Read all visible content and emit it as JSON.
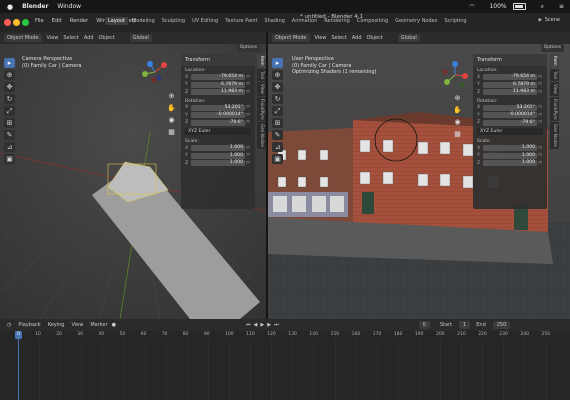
{
  "mac_menu": {
    "app": "Blender",
    "window": "Window",
    "battery": "100%"
  },
  "topbar": {
    "menus": [
      "File",
      "Edit",
      "Render",
      "Window",
      "Help"
    ],
    "tabs": [
      "Layout",
      "Modeling",
      "Sculpting",
      "UV Editing",
      "Texture Paint",
      "Shading",
      "Animation",
      "Rendering",
      "Compositing",
      "Geometry Nodes",
      "Scripting"
    ],
    "active_tab": "Layout",
    "title": "* untitled - Blender 4.1",
    "scene": "Scene"
  },
  "viewport_header": {
    "mode": "Object Mode",
    "menus": [
      "View",
      "Select",
      "Add",
      "Object"
    ],
    "orientation": "Global",
    "options": "Options"
  },
  "left_viewport": {
    "line1": "Camera Perspective",
    "line2": "(0) Family Car | Camera",
    "transform": {
      "title": "Transform",
      "location_label": "Location:",
      "location": [
        "-79.654 m",
        "6.7879 m",
        "11.983 m"
      ],
      "rotation_label": "Rotation:",
      "rotation": [
        "53.201°",
        "-0.000014°",
        "-79.6°"
      ],
      "rotation_mode": "XYZ Euler",
      "scale_label": "Scale:",
      "scale": [
        "1.000",
        "1.000",
        "1.000"
      ]
    }
  },
  "right_viewport": {
    "line1": "User Perspective",
    "line2": "(0) Family Car | Camera",
    "line3": "Optimizing Shaders (1 remaining)",
    "transform": {
      "title": "Transform",
      "location_label": "Location:",
      "location": [
        "-79.654 m",
        "6.7879 m",
        "11.983 m"
      ],
      "rotation_label": "Rotation:",
      "rotation": [
        "53.201°",
        "-0.000014°",
        "-79.6°"
      ],
      "rotation_mode": "XYZ Euler",
      "scale_label": "Scale:",
      "scale": [
        "1.000",
        "1.000",
        "1.000"
      ]
    }
  },
  "axes": [
    "X",
    "Y",
    "Z"
  ],
  "side_tabs": [
    "Item",
    "Tool",
    "View",
    "Fluid/Pyro",
    "Gen Nodes"
  ],
  "timeline": {
    "menus": [
      "Playback",
      "Keying",
      "View",
      "Marker"
    ],
    "current_frame": "0",
    "start_label": "Start",
    "start": "1",
    "end_label": "End",
    "end": "250",
    "playhead": "0",
    "ticks": [
      "10",
      "20",
      "30",
      "40",
      "50",
      "60",
      "70",
      "80",
      "90",
      "100",
      "110",
      "120",
      "130",
      "140",
      "150",
      "160",
      "170",
      "180",
      "190",
      "200",
      "210",
      "220",
      "230",
      "240",
      "250"
    ]
  },
  "colors": {
    "accent": "#4772b3",
    "x_axis": "#e0433f",
    "y_axis": "#7fb33b",
    "z_axis": "#3b82e0"
  }
}
